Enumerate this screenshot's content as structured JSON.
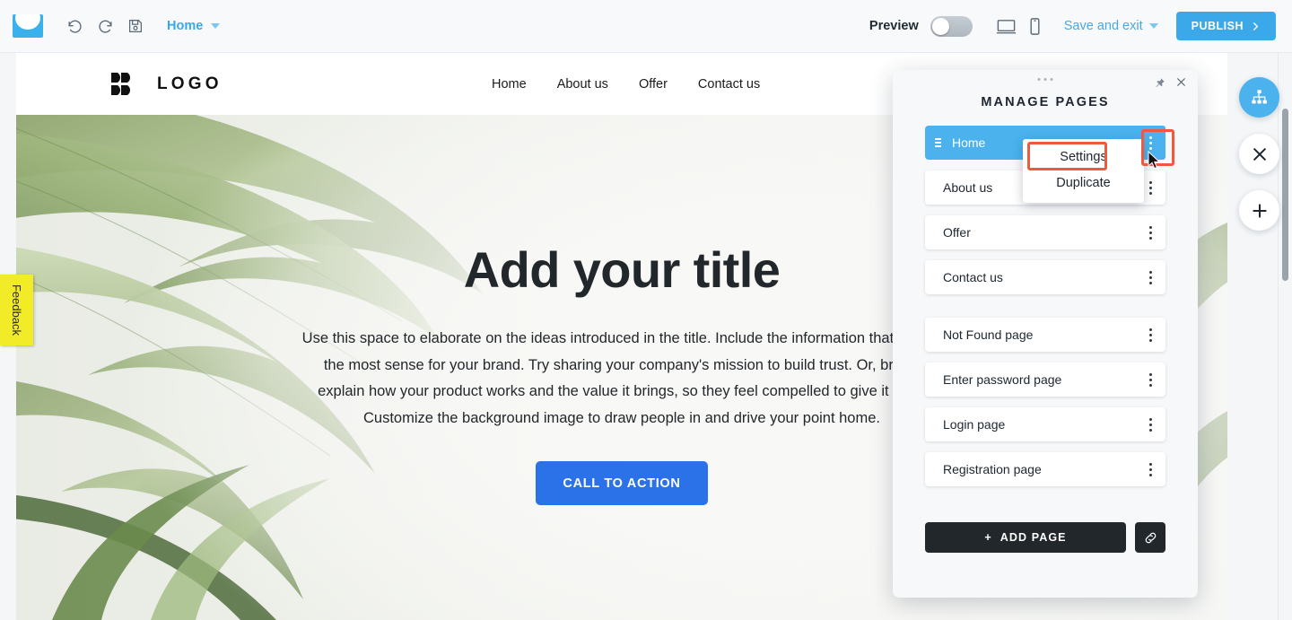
{
  "toolbar": {
    "brand_icon": "mail-logo-icon",
    "undo_icon": "undo-icon",
    "redo_icon": "redo-icon",
    "save_icon": "save-disk-icon",
    "page_selector_label": "Home",
    "preview_label": "Preview",
    "preview_enabled": false,
    "desktop_icon": "desktop-monitor-icon",
    "mobile_icon": "mobile-phone-icon",
    "save_exit_label": "Save and exit",
    "publish_label": "PUBLISH",
    "accent_blue": "#3ba8ea"
  },
  "feedback": {
    "label": "Feedback",
    "color": "#f2ec28"
  },
  "site": {
    "logo_text": "LOGO",
    "nav": [
      {
        "label": "Home"
      },
      {
        "label": "About us"
      },
      {
        "label": "Offer"
      },
      {
        "label": "Contact us"
      }
    ],
    "hero": {
      "title": "Add your title",
      "body": "Use this space to elaborate on the ideas introduced in the title. Include the information that makes the most sense for your brand. Try sharing your company's mission to build trust. Or, briefly explain how your product works and the value it brings, so they feel compelled to give it a go. Customize the background image to draw people in and drive your point home.",
      "cta_label": "CALL TO ACTION",
      "cta_color": "#2b72e8"
    }
  },
  "fabs": [
    {
      "name": "sitemap-icon",
      "active": true
    },
    {
      "name": "close-icon",
      "active": false
    },
    {
      "name": "add-icon",
      "active": false
    }
  ],
  "panel": {
    "title": "MANAGE PAGES",
    "pin_icon": "pin-icon",
    "close_icon": "close-icon",
    "grip_icon": "drag-grip-icon",
    "selected_color": "#4bb2ee",
    "pages": [
      {
        "label": "Home",
        "selected": true,
        "kebab_highlighted": true
      },
      {
        "label": "About us",
        "selected": false,
        "kebab_highlighted": false
      },
      {
        "label": "Offer",
        "selected": false,
        "kebab_highlighted": false
      },
      {
        "label": "Contact us",
        "selected": false,
        "kebab_highlighted": false
      }
    ],
    "system_pages": [
      {
        "label": "Not Found page"
      },
      {
        "label": "Enter password page"
      },
      {
        "label": "Login page"
      },
      {
        "label": "Registration page"
      }
    ],
    "context_menu": {
      "items": [
        {
          "label": "Settings",
          "highlighted": true
        },
        {
          "label": "Duplicate",
          "highlighted": false
        }
      ]
    },
    "add_page_label": "ADD PAGE",
    "add_page_plus": "+",
    "link_icon": "link-chain-icon",
    "highlight_color": "#f05a3c"
  }
}
